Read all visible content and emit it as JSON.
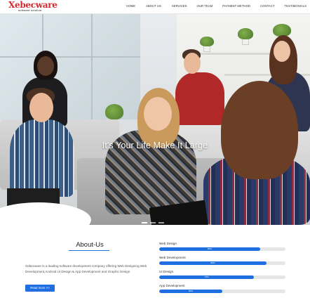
{
  "brand": {
    "name": "Xebecware",
    "tagline": "software solution",
    "color": "#d9262f"
  },
  "nav": {
    "items": [
      "HOME",
      "ABOUT US",
      "SERVICES",
      "OUR TEAM",
      "PAYMENT METHOD",
      "CONTACT",
      "TESTIMONIALS"
    ]
  },
  "hero": {
    "title": "It's Your Life Make It Large",
    "slides": 3,
    "active_slide": 1
  },
  "about": {
    "title": "About-Us",
    "text": "Xebecware is a leading software development company offering Web Designing,Web Development,Android UI Design & App Development and Graphic Design",
    "button_label": "Read more >>",
    "accent_color": "#1f6fe0"
  },
  "skills": [
    {
      "label": "Web Design",
      "percent": 80,
      "percent_label": "80%"
    },
    {
      "label": "Web Development",
      "percent": 85,
      "percent_label": "85%"
    },
    {
      "label": "UI Design",
      "percent": 75,
      "percent_label": "75%"
    },
    {
      "label": "App Development",
      "percent": 50,
      "percent_label": "50%"
    }
  ]
}
